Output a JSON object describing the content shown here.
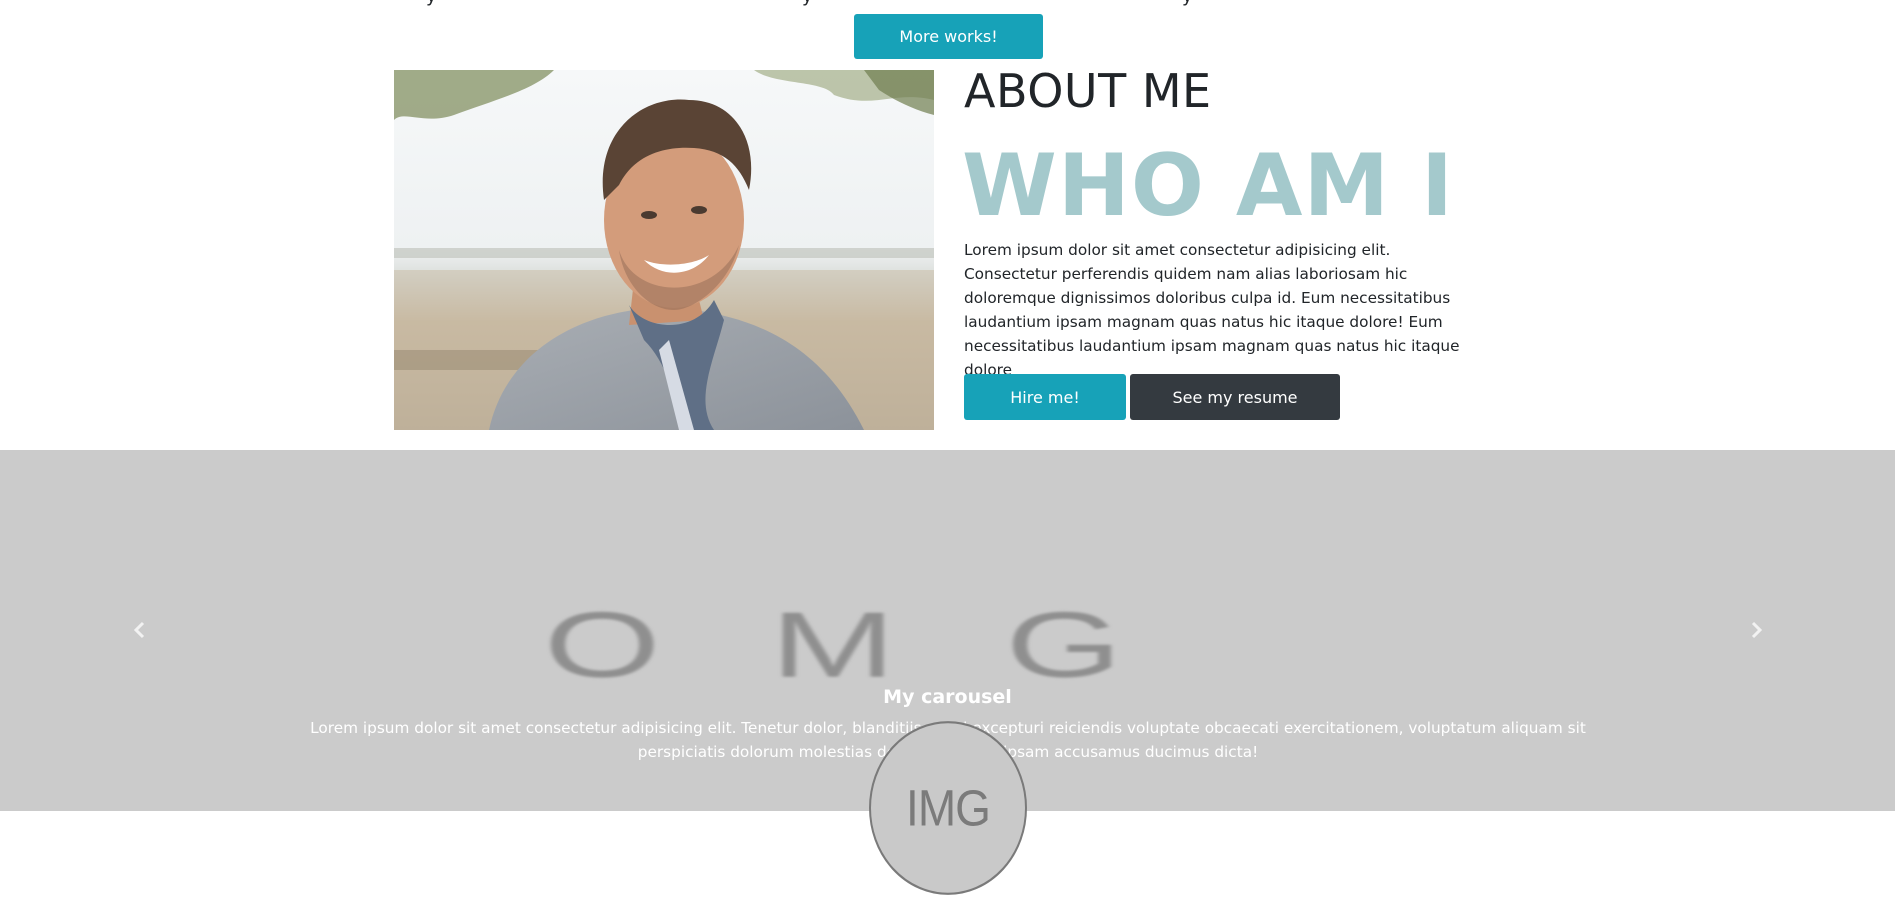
{
  "top": {
    "more_works_label": "More works!"
  },
  "about": {
    "heading": "ABOUT ME",
    "subheading": "WHO AM I",
    "text": "Lorem ipsum dolor sit amet consectetur adipisicing elit. Consectetur perferendis quidem nam alias laboriosam hic doloremque dignissimos doloribus culpa id. Eum necessitatibus laudantium ipsam magnam quas natus hic itaque dolore! Eum necessitatibus laudantium ipsam magnam quas natus hic itaque dolore",
    "hire_label": "Hire me!",
    "resume_label": "See my resume"
  },
  "carousel": {
    "placeholder_text": "OMG",
    "caption_title": "My carousel",
    "caption_text": "Lorem ipsum dolor sit amet consectetur adipisicing elit. Tenetur dolor, blanditiis quasi excepturi reiciendis voluptate obcaecati exercitationem, voluptatum aliquam sit perspiciatis dolorum molestias deserunt nemo, ipsam accusamus ducimus dicta!",
    "prev_icon": "chevron-left-icon",
    "next_icon": "chevron-right-icon"
  },
  "avatar": {
    "placeholder_text": "IMG"
  },
  "colors": {
    "info": "#17a2b8",
    "dark": "#343a40",
    "who_am_i": "#a4c9cc",
    "carousel_bg": "#cbcbcb"
  }
}
